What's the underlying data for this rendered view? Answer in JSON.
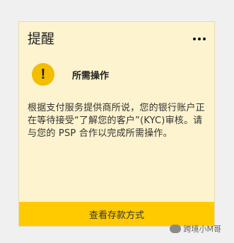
{
  "card": {
    "title": "提醒",
    "status_label": "所需操作",
    "message": "根据支付服务提供商所说，您的银行账户正在等待接受“了解您的客户”(KYC)审核。请与您的 PSP 合作以完成所需操作。",
    "action_label": "查看存款方式"
  },
  "icons": {
    "more": "more-options-icon",
    "warning": "warning-icon"
  },
  "watermark": {
    "text": "跨境小M哥"
  },
  "colors": {
    "card_background": "#fdf3ce",
    "button_background": "#ffca00",
    "warning_icon": "#f3bd00"
  }
}
